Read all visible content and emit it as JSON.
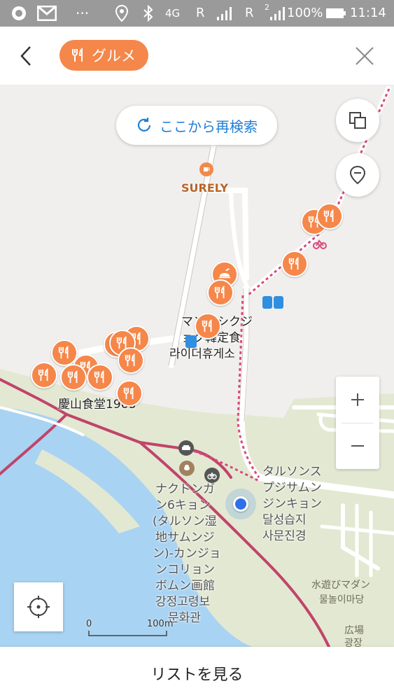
{
  "status_bar": {
    "dots": "···",
    "network": "4G",
    "roaming_1": "R",
    "roaming_2": "R",
    "sim2": "2",
    "battery": "100%",
    "time": "11:14",
    "icons": [
      "record-icon",
      "gmail-icon",
      "location-icon",
      "bluetooth-icon",
      "signal-icon",
      "battery-icon"
    ]
  },
  "header": {
    "chip_label": "グルメ",
    "icons": [
      "back-icon",
      "fork-knife-icon",
      "close-icon"
    ]
  },
  "map": {
    "research_label": "ここから再検索",
    "labels": {
      "surely": "SURELY",
      "manpasik_1": "マンパシクジ",
      "manpasik_2": "ョク韓定食",
      "rider_rest": "라이더휴게소",
      "gyeongsan": "慶山食堂1968",
      "nakdong_1": "ナクドンガ",
      "nakdong_2": "ン6キョン",
      "nakdong_3": "(タルソン湿",
      "nakdong_4": "地サムンジ",
      "nakdong_5": "ン)-カンジョ",
      "nakdong_6": "ンコリョン",
      "nakdong_7": "ボムン画館",
      "nakdong_8": "강정고령보",
      "nakdong_9": "문화관",
      "dalseong_1": "タルソンス",
      "dalseong_2": "プジサムン",
      "dalseong_3": "ジンキョン",
      "dalseong_4": "달성습지",
      "dalseong_5": "사문진경",
      "water_play_1": "水遊びマダン",
      "water_play_2": "물놀이마당",
      "plaza_1": "広場",
      "plaza_2": "광장"
    },
    "scale": {
      "zero": "0",
      "distance": "100m"
    },
    "icons": [
      "refresh-icon",
      "layers-icon",
      "marker-filter-icon",
      "plus-icon",
      "minus-icon",
      "crosshair-icon",
      "cafe-icon",
      "bus-stop-icon",
      "bike-icon",
      "parking-icon",
      "museum-icon",
      "current-location-icon"
    ]
  },
  "bottom": {
    "list_label": "リストを見る"
  },
  "colors": {
    "accent": "#f5874a",
    "link_blue": "#1f7fd6",
    "water": "#a9d3f2",
    "park": "#e3e8d2",
    "route": "#c0446a"
  }
}
